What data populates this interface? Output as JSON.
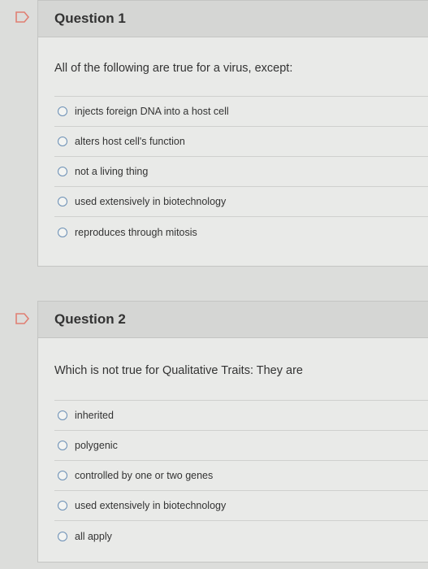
{
  "questions": [
    {
      "title": "Question 1",
      "prompt": "All of the following are true for a virus, except:",
      "options": [
        "injects foreign DNA into a host cell",
        "alters host cell's function",
        "not a living thing",
        "used extensively in biotechnology",
        "reproduces through mitosis"
      ]
    },
    {
      "title": "Question 2",
      "prompt": "Which is not true for Qualitative Traits: They are",
      "options": [
        "inherited",
        "polygenic",
        "controlled by one or two genes",
        "used extensively in biotechnology",
        "all apply"
      ]
    }
  ],
  "colors": {
    "flag_outline": "#e07f73",
    "radio_border": "#6b8fb5"
  },
  "icons": [
    "flag-icon",
    "radio-unselected-icon"
  ]
}
